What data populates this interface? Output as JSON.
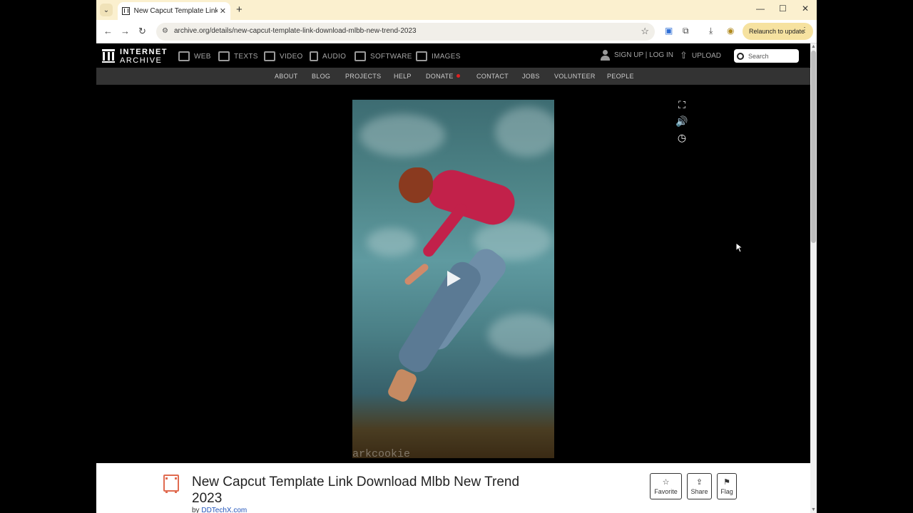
{
  "browser": {
    "tab_title": "New Capcut Template Link Dow",
    "url": "archive.org/details/new-capcut-template-link-download-mlbb-new-trend-2023",
    "relaunch_label": "Relaunch to update"
  },
  "ia_nav": {
    "logo_line1": "INTERNET",
    "logo_line2": "ARCHIVE",
    "media": [
      "WEB",
      "TEXTS",
      "VIDEO",
      "AUDIO",
      "SOFTWARE",
      "IMAGES"
    ],
    "signup": "SIGN UP | LOG IN",
    "upload": "UPLOAD",
    "search_placeholder": "Search"
  },
  "sub_nav": [
    "ABOUT",
    "BLOG",
    "PROJECTS",
    "HELP",
    "DONATE",
    "CONTACT",
    "JOBS",
    "VOLUNTEER",
    "PEOPLE"
  ],
  "video": {
    "watermark": "arkcookie"
  },
  "item": {
    "title": "New Capcut Template Link Download Mlbb New Trend 2023",
    "by_label": "by",
    "author": "DDTechX.com",
    "actions": [
      "Favorite",
      "Share",
      "Flag"
    ]
  },
  "colors": {
    "tab_strip": "#fbf0cf",
    "relaunch": "#f6e2a0",
    "donate_dot": "#e02020",
    "item_icon": "#e06b50",
    "author_link": "#2255bb"
  }
}
